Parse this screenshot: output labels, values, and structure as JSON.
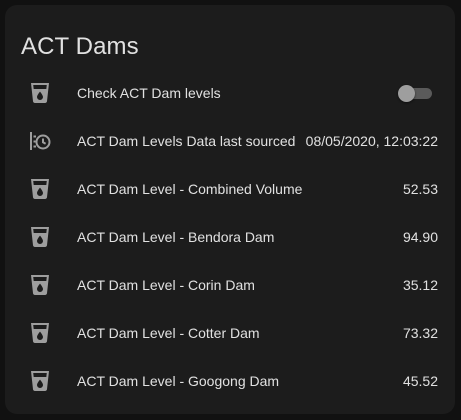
{
  "card": {
    "title": "ACT Dams"
  },
  "rows": [
    {
      "label": "Check ACT Dam levels",
      "icon": "cup-water-icon",
      "type": "toggle",
      "state": "off"
    },
    {
      "label": "ACT Dam Levels Data last sourced",
      "icon": "timer-clock-icon",
      "type": "value",
      "value": "08/05/2020, 12:03:22"
    },
    {
      "label": "ACT Dam Level - Combined Volume",
      "icon": "cup-water-icon",
      "type": "value",
      "value": "52.53"
    },
    {
      "label": "ACT Dam Level - Bendora Dam",
      "icon": "cup-water-icon",
      "type": "value",
      "value": "94.90"
    },
    {
      "label": "ACT Dam Level - Corin Dam",
      "icon": "cup-water-icon",
      "type": "value",
      "value": "35.12"
    },
    {
      "label": "ACT Dam Level - Cotter Dam",
      "icon": "cup-water-icon",
      "type": "value",
      "value": "73.32"
    },
    {
      "label": "ACT Dam Level - Googong Dam",
      "icon": "cup-water-icon",
      "type": "value",
      "value": "45.52"
    }
  ],
  "colors": {
    "background": "#111111",
    "card": "#1c1c1c",
    "text": "#e1e1e1",
    "icon": "#9e9e9e"
  }
}
